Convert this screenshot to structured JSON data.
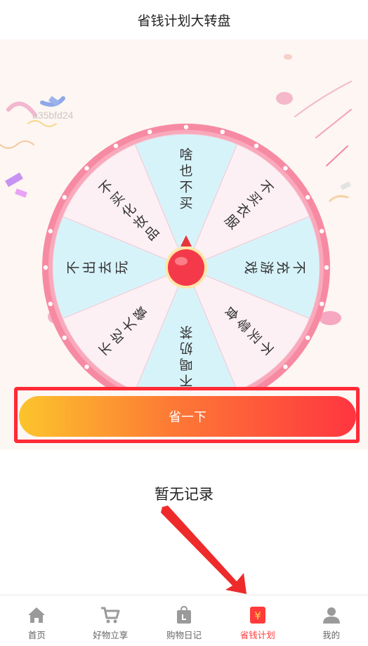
{
  "header": {
    "title": "省钱计划大转盘"
  },
  "stage": {
    "watermark": "a35bfd24"
  },
  "wheel": {
    "segments": [
      "啥也不买",
      "不买衣服",
      "不充游戏",
      "不买零食",
      "不喝奶茶",
      "不吃大餐",
      "不出去玩",
      "不买化妆品"
    ],
    "colors": {
      "light_blue": "#d7f3fa",
      "light_pink": "#fdf0f4",
      "rim": "#f78aa3",
      "rim_light": "#f9a9bb"
    }
  },
  "spin": {
    "label": "省一下"
  },
  "records": {
    "empty_text": "暂无记录"
  },
  "tabbar": {
    "items": [
      {
        "label": "首页",
        "icon": "home-icon"
      },
      {
        "label": "好物立享",
        "icon": "cart-icon"
      },
      {
        "label": "购物日记",
        "icon": "shopping-bag-icon"
      },
      {
        "label": "省钱计划",
        "icon": "savings-plan-icon",
        "active": true
      },
      {
        "label": "我的",
        "icon": "user-icon"
      }
    ]
  },
  "colors": {
    "accent": "#ff3b3b",
    "highlight": "#ff2a36"
  }
}
